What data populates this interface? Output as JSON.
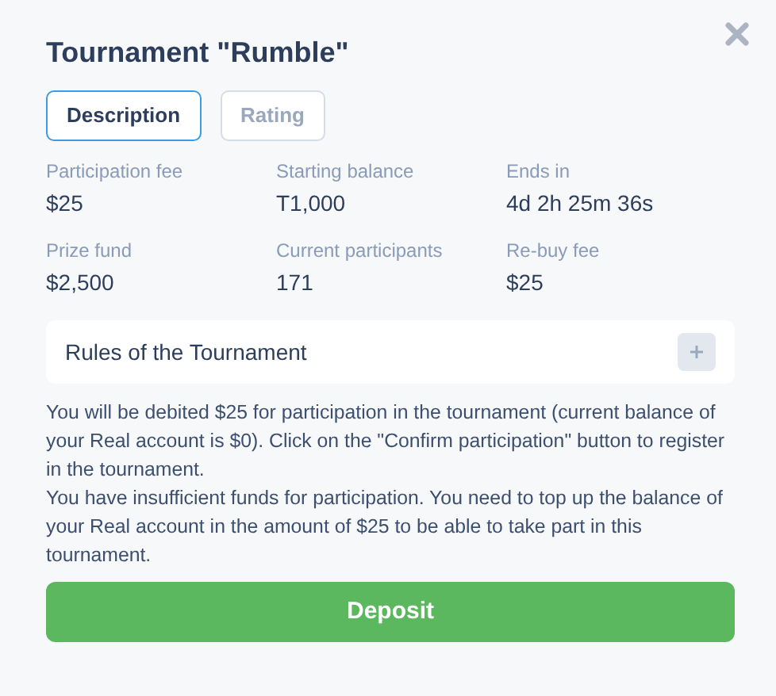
{
  "dialog": {
    "title": "Tournament \"Rumble\""
  },
  "tabs": [
    {
      "label": "Description",
      "selected": true
    },
    {
      "label": "Rating",
      "selected": false
    }
  ],
  "stats": [
    {
      "label": "Participation fee",
      "value": "$25"
    },
    {
      "label": "Starting balance",
      "value": "T1,000"
    },
    {
      "label": "Ends in",
      "value": "4d 2h 25m 36s"
    },
    {
      "label": "Prize fund",
      "value": "$2,500"
    },
    {
      "label": "Current participants",
      "value": "171"
    },
    {
      "label": "Re-buy fee",
      "value": "$25"
    }
  ],
  "rules": {
    "title": "Rules of the Tournament",
    "expanded": false
  },
  "messages": [
    "You will be debited $25 for participation in the tournament (current balance of your Real account is $0). Click on the \"Confirm participation\" button to register in the tournament.",
    "You have insufficient funds for participation. You need to top up the balance of your Real account in the amount of $25 to be able to take part in this tournament."
  ],
  "button": {
    "label": "Deposit"
  }
}
